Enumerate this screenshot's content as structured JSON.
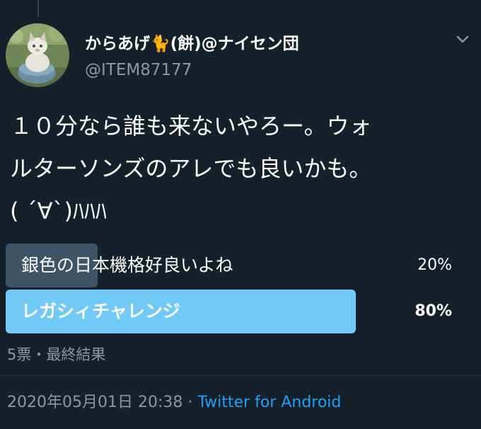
{
  "author": {
    "display_name": "からあげ🐈(餅)@ナイセン団",
    "handle": "@ITEM87177"
  },
  "icons": {
    "avatar": "cat-avatar-photo",
    "more": "chevron-down-icon"
  },
  "tweet": {
    "lines": [
      "１０分なら誰も来ないやろー。ウォ",
      "ルターソンズのアレでも良いかも。",
      "( ´∀`)ﾊﾊﾊ"
    ]
  },
  "poll": {
    "options": [
      {
        "label": "銀色の日本機格好良いよね",
        "percent_text": "20%",
        "percent": 20,
        "winner": false
      },
      {
        "label": "レガシィチャレンジ",
        "percent_text": "80%",
        "percent": 80,
        "winner": true
      }
    ],
    "meta": "5票・最終結果"
  },
  "footer": {
    "timestamp": "2020年05月01日 20:38 · ",
    "source": "Twitter for Android"
  },
  "colors": {
    "background": "#15202b",
    "secondary_text": "#8899a6",
    "link": "#1da1f2",
    "poll_winner": "#71c9f8",
    "poll_other": "#3d5466"
  }
}
